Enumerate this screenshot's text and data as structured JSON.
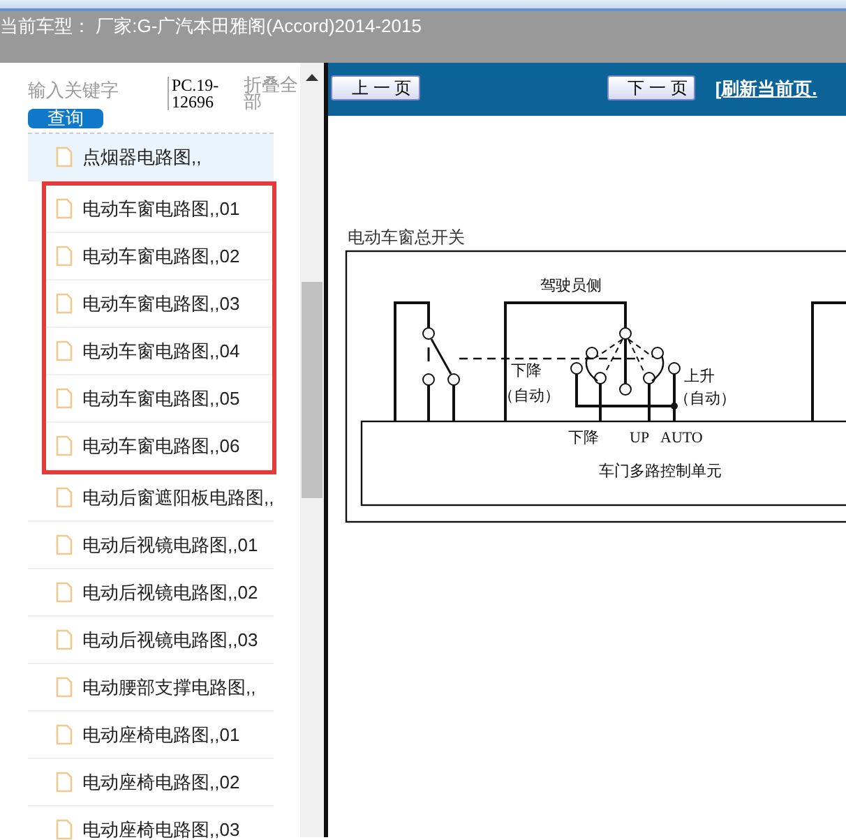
{
  "header": {
    "title": "当前车型： 厂家:G-广汽本田雅阁(Accord)2014-2015"
  },
  "sidebar": {
    "search": {
      "placeholder": "输入关键字"
    },
    "search_button": "查询",
    "code": "PC.19-12696",
    "collapse_all": "折叠全部",
    "items": [
      {
        "label": "点烟器电路图,,",
        "selected": true,
        "marked": false
      },
      {
        "label": "电动车窗电路图,,01",
        "selected": false,
        "marked": true
      },
      {
        "label": "电动车窗电路图,,02",
        "selected": false,
        "marked": true
      },
      {
        "label": "电动车窗电路图,,03",
        "selected": false,
        "marked": true
      },
      {
        "label": "电动车窗电路图,,04",
        "selected": false,
        "marked": true
      },
      {
        "label": "电动车窗电路图,,05",
        "selected": false,
        "marked": true
      },
      {
        "label": "电动车窗电路图,,06",
        "selected": false,
        "marked": true
      },
      {
        "label": "电动后窗遮阳板电路图,,",
        "selected": false,
        "marked": false
      },
      {
        "label": "电动后视镜电路图,,01",
        "selected": false,
        "marked": false
      },
      {
        "label": "电动后视镜电路图,,02",
        "selected": false,
        "marked": false
      },
      {
        "label": "电动后视镜电路图,,03",
        "selected": false,
        "marked": false
      },
      {
        "label": "电动腰部支撑电路图,,",
        "selected": false,
        "marked": false
      },
      {
        "label": "电动座椅电路图,,01",
        "selected": false,
        "marked": false
      },
      {
        "label": "电动座椅电路图,,02",
        "selected": false,
        "marked": false
      },
      {
        "label": "电动座椅电路图,,03",
        "selected": false,
        "marked": false
      }
    ]
  },
  "viewer": {
    "prev_button": "上 一 页",
    "next_button": "下 一 页",
    "refresh_link": "[刷新当前页.",
    "diagram": {
      "title": "电动车窗总开关",
      "labels": [
        {
          "text": "驾驶员侧"
        },
        {
          "text": "下降"
        },
        {
          "text": "（自动）"
        },
        {
          "text": "上升"
        },
        {
          "text": "（自动）"
        },
        {
          "text": "下降"
        },
        {
          "text": "UP"
        },
        {
          "text": "AUTO"
        },
        {
          "text": "车门多路控制单元"
        }
      ]
    }
  }
}
